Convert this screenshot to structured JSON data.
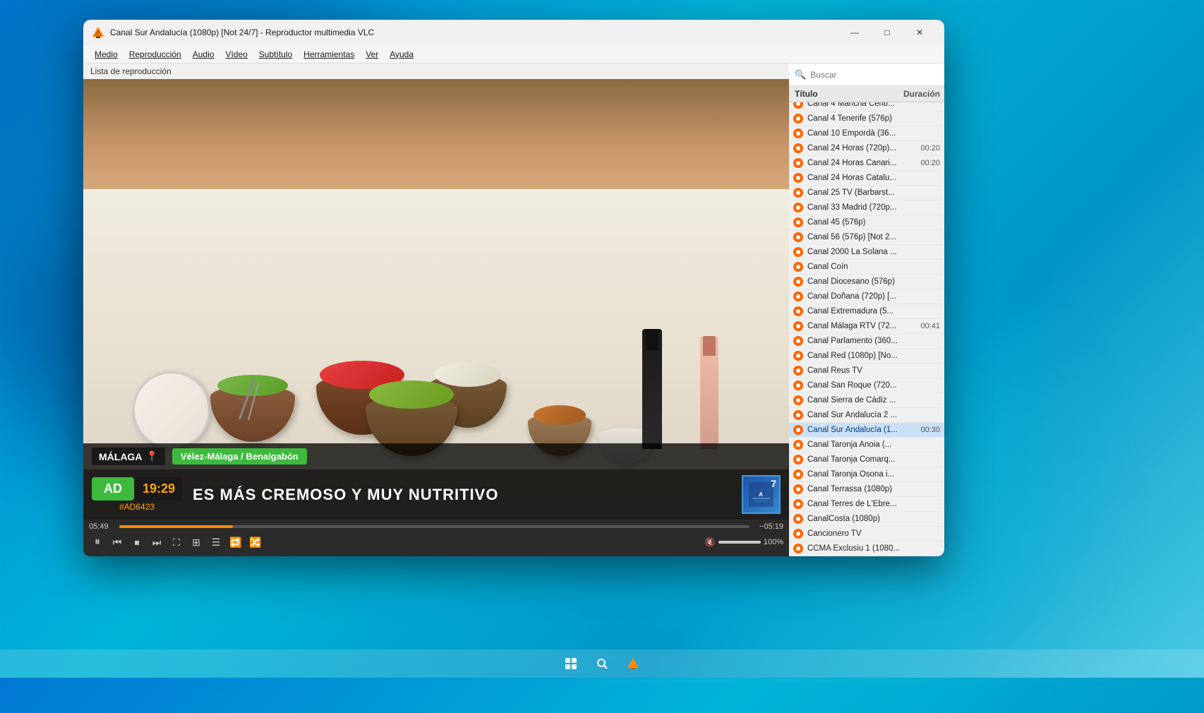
{
  "window": {
    "title": "Canal Sur Andalucía (1080p) [Not 24/7] - Reproductor multimedia VLC",
    "minimize_label": "—",
    "maximize_label": "□",
    "close_label": "✕"
  },
  "menu": {
    "items": [
      "Medio",
      "Reproducción",
      "Audio",
      "Vídeo",
      "Subtítulo",
      "Herramientas",
      "Ver",
      "Ayuda"
    ]
  },
  "playlist_label": "Lista de reproducción",
  "video": {
    "location": "MÁLAGA",
    "location_detail": "Vélez-Málaga / Benalgabón",
    "ad_label": "AD",
    "time_label": "19:29",
    "ad_code": "#AD6423",
    "subtitle": "ES MÁS CREMOSO Y MUY NUTRITIVO",
    "channel_number": "7"
  },
  "controls": {
    "time_current": "05:49",
    "time_remaining": "−05:19",
    "volume_percent": "100%",
    "progress_percent": 18
  },
  "playlist": {
    "search_placeholder": "Buscar",
    "col_title": "Título",
    "col_duration": "Duración",
    "items": [
      {
        "title": "Canal 4 Mancha Centr...",
        "duration": "",
        "active": false
      },
      {
        "title": "Canal 4 Tenerife (576p)",
        "duration": "",
        "active": false
      },
      {
        "title": "Canal 10 Empordà (36...",
        "duration": "",
        "active": false
      },
      {
        "title": "Canal 24 Horas (720p)...",
        "duration": "00:20",
        "active": false
      },
      {
        "title": "Canal 24 Horas Canari...",
        "duration": "00:20",
        "active": false
      },
      {
        "title": "Canal 24 Horas Catalu...",
        "duration": "",
        "active": false
      },
      {
        "title": "Canal 25 TV (Barbarst...",
        "duration": "",
        "active": false
      },
      {
        "title": "Canal 33 Madrid (720p...",
        "duration": "",
        "active": false
      },
      {
        "title": "Canal 45 (576p)",
        "duration": "",
        "active": false
      },
      {
        "title": "Canal 56 (576p) [Not 2...",
        "duration": "",
        "active": false
      },
      {
        "title": "Canal 2000 La Solana ...",
        "duration": "",
        "active": false
      },
      {
        "title": "Canal Coín",
        "duration": "",
        "active": false
      },
      {
        "title": "Canal Diocesano (576p)",
        "duration": "",
        "active": false
      },
      {
        "title": "Canal Doñana (720p) [...",
        "duration": "",
        "active": false
      },
      {
        "title": "Canal Extremadura (5...",
        "duration": "",
        "active": false
      },
      {
        "title": "Canal Málaga RTV (72...",
        "duration": "00:41",
        "active": false
      },
      {
        "title": "Canal Parlamento (360...",
        "duration": "",
        "active": false
      },
      {
        "title": "Canal Red (1080p) [No...",
        "duration": "",
        "active": false
      },
      {
        "title": "Canal Reus TV",
        "duration": "",
        "active": false
      },
      {
        "title": "Canal San Roque (720...",
        "duration": "",
        "active": false
      },
      {
        "title": "Canal Sierra de Cádiz ...",
        "duration": "",
        "active": false
      },
      {
        "title": "Canal Sur Andalucía 2 ...",
        "duration": "",
        "active": false
      },
      {
        "title": "Canal Sur Andalucía (1...",
        "duration": "00:30",
        "active": true
      },
      {
        "title": "Canal Taronja Anoia (...",
        "duration": "",
        "active": false
      },
      {
        "title": "Canal Taronja Comarq...",
        "duration": "",
        "active": false
      },
      {
        "title": "Canal Taronja Osona i...",
        "duration": "",
        "active": false
      },
      {
        "title": "Canal Terrassa (1080p)",
        "duration": "",
        "active": false
      },
      {
        "title": "Canal Terres de L'Ebre...",
        "duration": "",
        "active": false
      },
      {
        "title": "CanalCosta (1080p)",
        "duration": "",
        "active": false
      },
      {
        "title": "Cancionero TV",
        "duration": "",
        "active": false
      },
      {
        "title": "CCMA Exclusiu 1 (1080...",
        "duration": "",
        "active": false
      }
    ]
  }
}
